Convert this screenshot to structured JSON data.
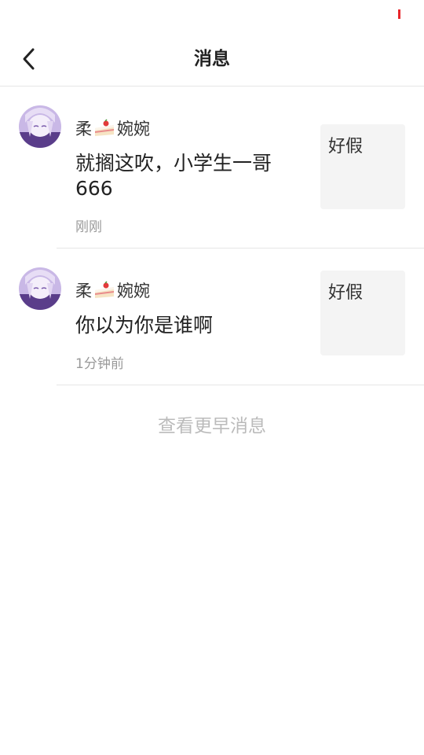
{
  "header": {
    "title": "消息",
    "back_icon": "chevron-left-icon"
  },
  "messages": [
    {
      "sender_prefix": "柔",
      "sender_emoji": "cake-icon",
      "sender_suffix": "婉婉",
      "text": "就搁这吹，小学生一哥666",
      "time": "刚刚",
      "quote": "好假"
    },
    {
      "sender_prefix": "柔",
      "sender_emoji": "cake-icon",
      "sender_suffix": "婉婉",
      "text": "你以为你是谁啊",
      "time": "1分钟前",
      "quote": "好假"
    }
  ],
  "footer": {
    "view_earlier": "查看更早消息"
  },
  "colors": {
    "status_accent": "#e8272c",
    "divider": "#e6e6e6",
    "quote_bg": "#f4f4f4",
    "muted_text": "#999999"
  }
}
